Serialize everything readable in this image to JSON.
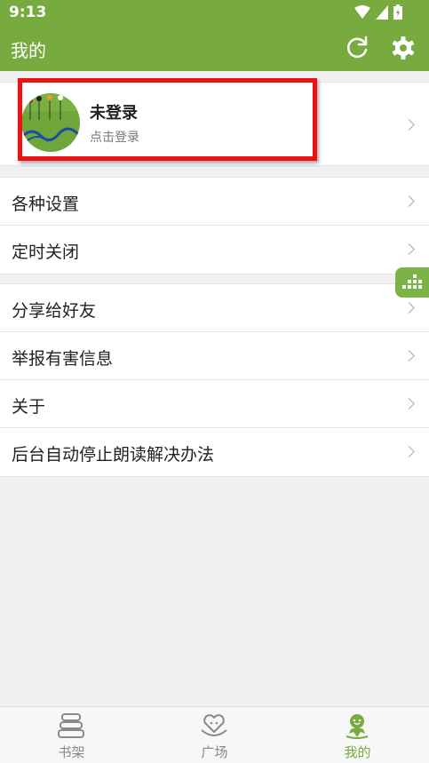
{
  "status_bar": {
    "time": "9:13"
  },
  "app_bar": {
    "title": "我的"
  },
  "profile": {
    "name": "未登录",
    "hint": "点击登录"
  },
  "groups": [
    {
      "items": [
        {
          "label": "各种设置"
        },
        {
          "label": "定时关闭"
        }
      ]
    },
    {
      "items": [
        {
          "label": "分享给好友"
        },
        {
          "label": "举报有害信息"
        },
        {
          "label": "关于"
        },
        {
          "label": "后台自动停止朗读解决办法"
        }
      ]
    }
  ],
  "bottom_nav": {
    "tabs": [
      {
        "label": "书架",
        "icon": "bookshelf-icon",
        "active": false
      },
      {
        "label": "广场",
        "icon": "heart-plaza-icon",
        "active": false
      },
      {
        "label": "我的",
        "icon": "user-mascot-icon",
        "active": true
      }
    ]
  },
  "colors": {
    "accent": "#77ab3f",
    "highlight": "#ee1111",
    "background": "#f0f0f0"
  }
}
